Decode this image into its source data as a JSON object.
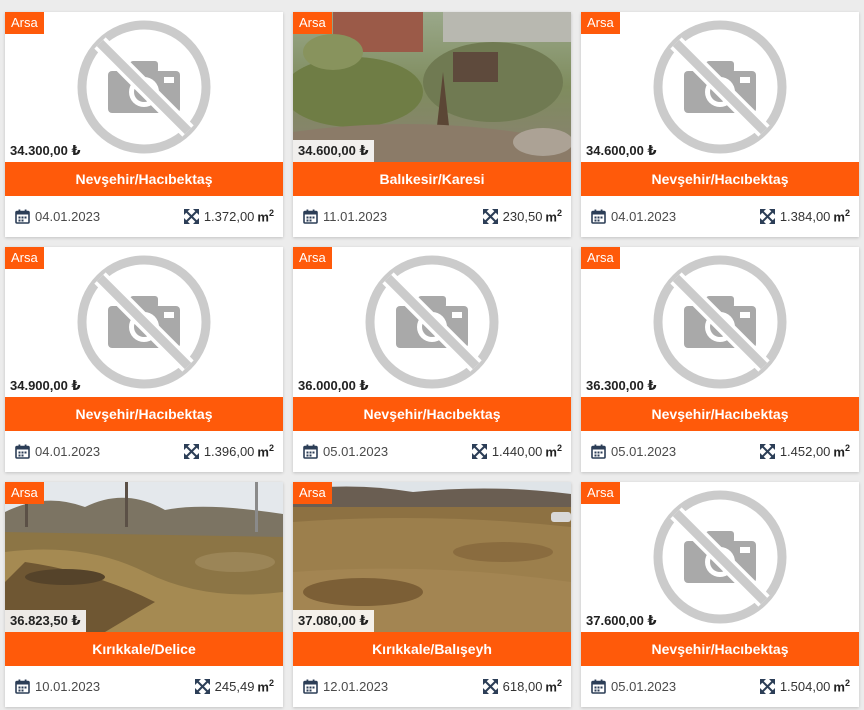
{
  "colors": {
    "accent": "#ff5a0a",
    "icon": "#2c3e57"
  },
  "area_unit": "m",
  "area_unit_sup": "2",
  "listings": [
    {
      "badge": "Arsa",
      "price": "34.300,00 ₺",
      "location": "Nevşehir/Hacıbektaş",
      "date": "04.01.2023",
      "area": "1.372,00",
      "image": "no-photo"
    },
    {
      "badge": "Arsa",
      "price": "34.600,00 ₺",
      "location": "Balıkesir/Karesi",
      "date": "11.01.2023",
      "area": "230,50",
      "image": "photo-brush"
    },
    {
      "badge": "Arsa",
      "price": "34.600,00 ₺",
      "location": "Nevşehir/Hacıbektaş",
      "date": "04.01.2023",
      "area": "1.384,00",
      "image": "no-photo"
    },
    {
      "badge": "Arsa",
      "price": "34.900,00 ₺",
      "location": "Nevşehir/Hacıbektaş",
      "date": "04.01.2023",
      "area": "1.396,00",
      "image": "no-photo"
    },
    {
      "badge": "Arsa",
      "price": "36.000,00 ₺",
      "location": "Nevşehir/Hacıbektaş",
      "date": "05.01.2023",
      "area": "1.440,00",
      "image": "no-photo"
    },
    {
      "badge": "Arsa",
      "price": "36.300,00 ₺",
      "location": "Nevşehir/Hacıbektaş",
      "date": "05.01.2023",
      "area": "1.452,00",
      "image": "no-photo"
    },
    {
      "badge": "Arsa",
      "price": "36.823,50 ₺",
      "location": "Kırıkkale/Delice",
      "date": "10.01.2023",
      "area": "245,49",
      "image": "photo-field-trees"
    },
    {
      "badge": "Arsa",
      "price": "37.080,00 ₺",
      "location": "Kırıkkale/Balışeyh",
      "date": "12.01.2023",
      "area": "618,00",
      "image": "photo-field-open"
    },
    {
      "badge": "Arsa",
      "price": "37.600,00 ₺",
      "location": "Nevşehir/Hacıbektaş",
      "date": "05.01.2023",
      "area": "1.504,00",
      "image": "no-photo"
    }
  ]
}
